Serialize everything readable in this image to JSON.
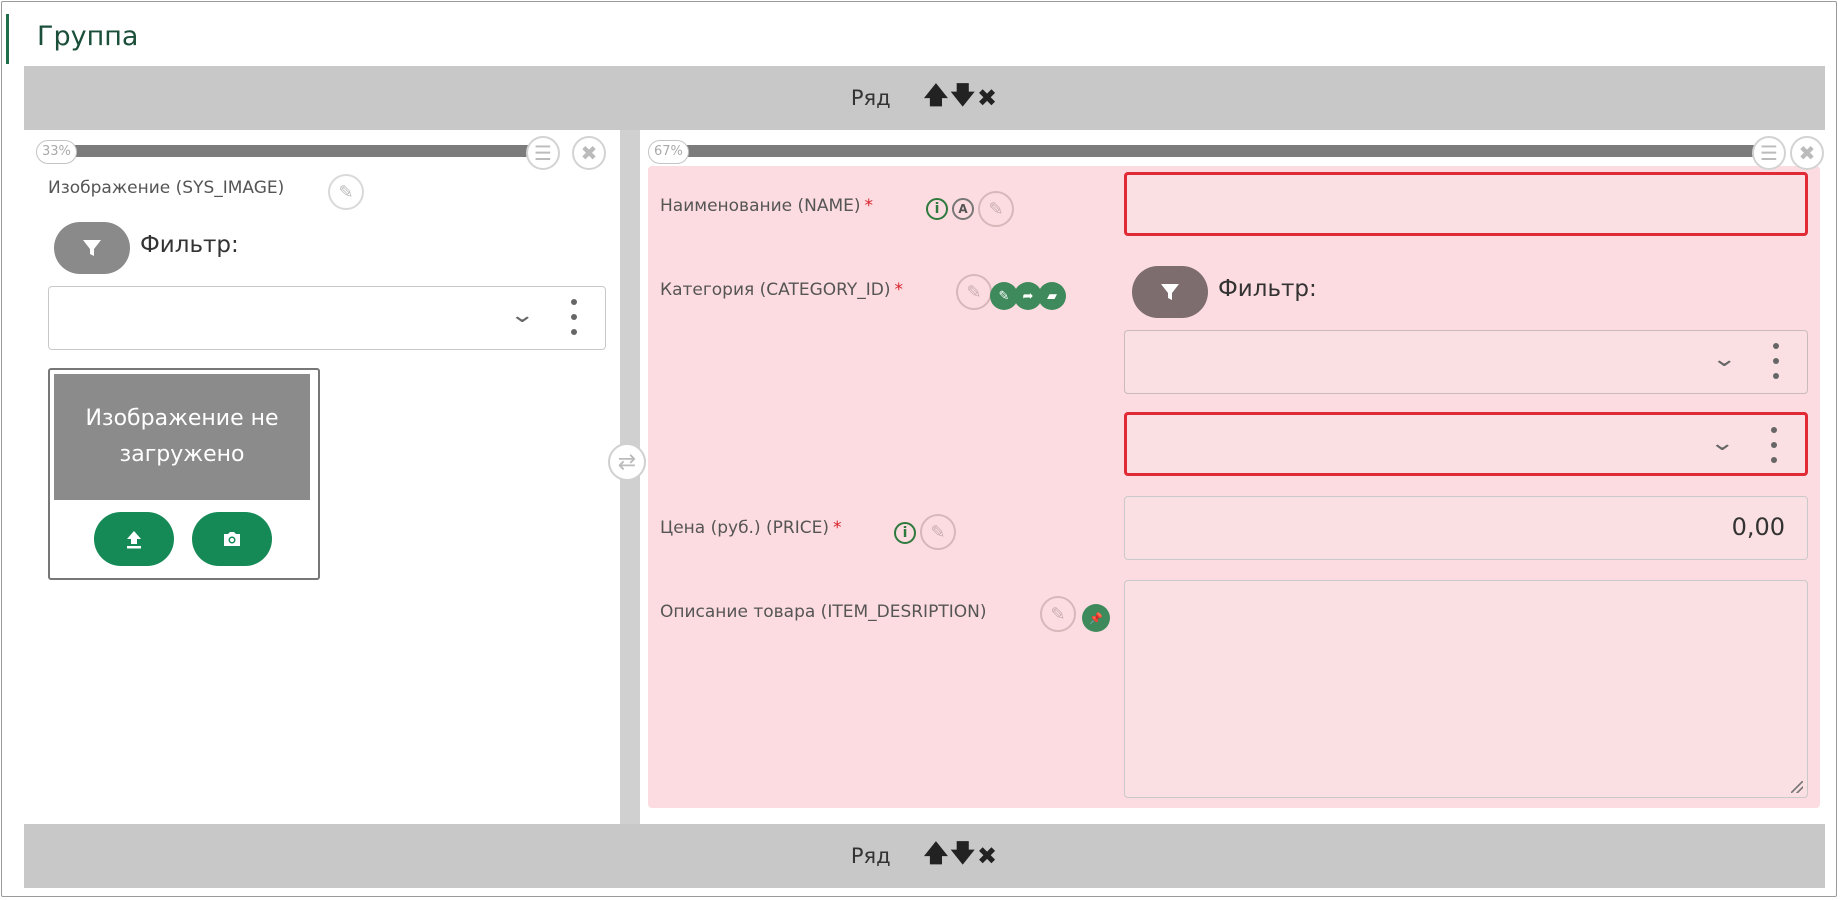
{
  "group": {
    "title": "Группа"
  },
  "rows": [
    {
      "label": "Ряд",
      "move_up": "🡅",
      "move_down": "🡇",
      "remove": "✖"
    },
    {
      "label": "Ряд",
      "move_up": "🡅",
      "move_down": "🡇",
      "remove": "✖"
    }
  ],
  "left_column": {
    "width_label": "33%",
    "image_field": {
      "label": "Изображение (SYS_IMAGE)",
      "filter_label": "Фильтр:",
      "placeholder_text": "Изображение не загружено",
      "upload_icon": "upload-icon",
      "camera_icon": "camera-icon"
    }
  },
  "right_column": {
    "width_label": "67%",
    "fields": {
      "name": {
        "label": "Наименование (NAME)",
        "required_mark": "*",
        "value": ""
      },
      "category": {
        "label": "Категория (CATEGORY_ID)",
        "required_mark": "*",
        "filter_label": "Фильтр:"
      },
      "price": {
        "label": "Цена (руб.) (PRICE)",
        "required_mark": "*",
        "value": "0,00"
      },
      "description": {
        "label": "Описание товара (ITEM_DESRIPTION)",
        "value": ""
      }
    }
  },
  "icons": {
    "info": "i",
    "auto": "A",
    "edit": "✎",
    "pencil": "✎",
    "arrow": "➦",
    "eraser": "▰",
    "pin": "📌",
    "swap": "⇄",
    "settings": "☰",
    "close": "✖"
  },
  "colors": {
    "accent_green": "#158a56",
    "error_red": "#e02a36",
    "pink_panel": "#fcdce0",
    "header_bar": "#c8c8c8"
  }
}
